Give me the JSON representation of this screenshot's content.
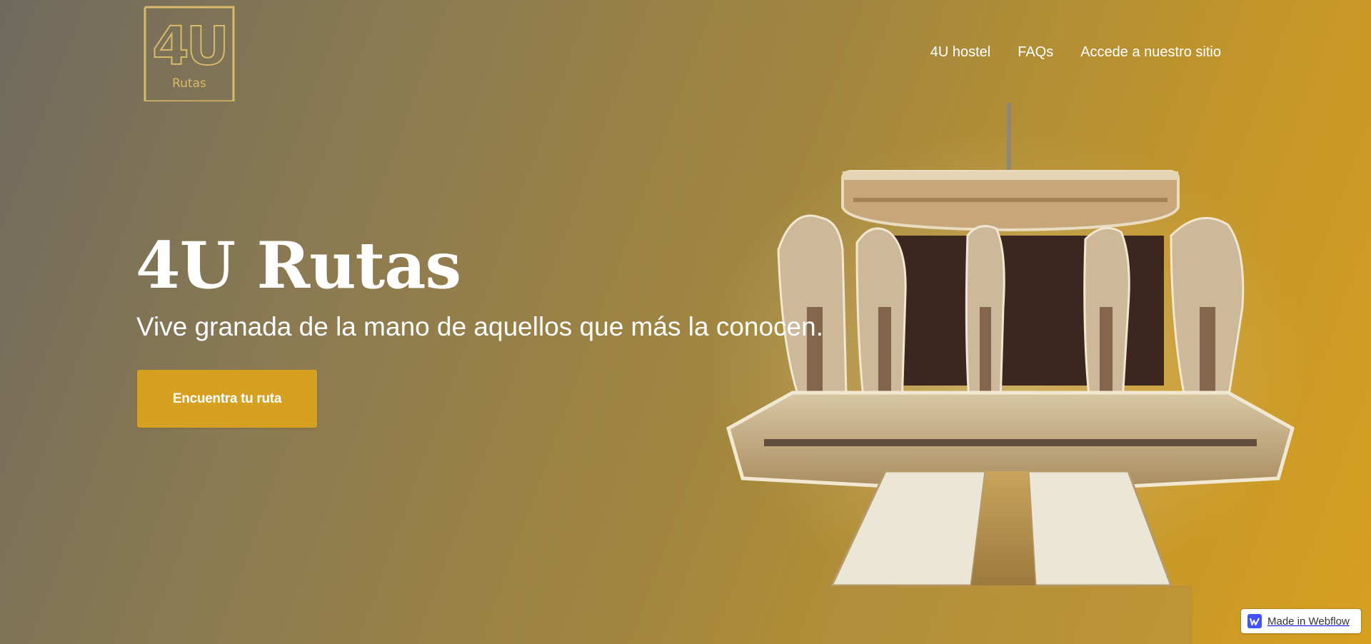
{
  "brand": {
    "logo_mark": "4U",
    "logo_subtext": "Rutas"
  },
  "nav": {
    "items": [
      {
        "label": "4U hostel"
      },
      {
        "label": "FAQs"
      },
      {
        "label": "Accede a nuestro sitio"
      }
    ]
  },
  "hero": {
    "title": "4U Rutas",
    "subtitle": "Vive granada de la mano de aquellos que más la conocen.",
    "cta_label": "Encuentra tu ruta",
    "illustration": "fountain-of-lions-illustration"
  },
  "badge": {
    "label": "Made in Webflow",
    "icon": "webflow-icon"
  },
  "colors": {
    "accent": "#d6a020",
    "gradient_start": "#6f6a5e",
    "gradient_end": "#d6a020",
    "logo_line": "#d9b96a",
    "text": "#ffffff"
  }
}
